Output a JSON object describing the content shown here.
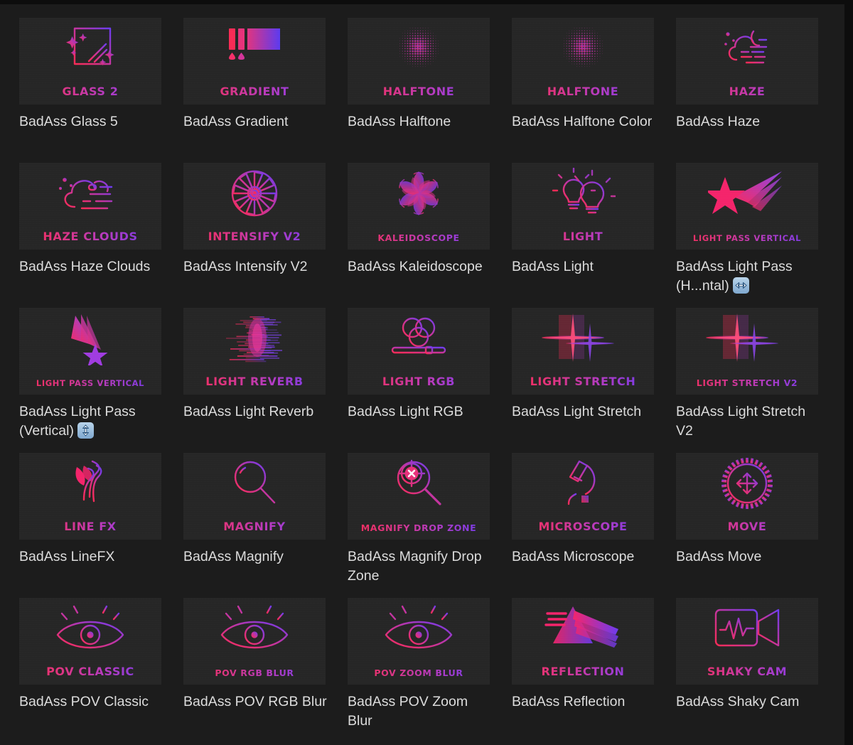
{
  "theme": {
    "page_bg": "#1c1c1c",
    "edge_bg": "#0d0d0d",
    "thumb_bg": "#262626",
    "label_color": "#dcdcdc",
    "gradient_start": "#fa2b55",
    "gradient_mid": "#b43bc4",
    "gradient_end": "#6c3bf0",
    "badge_bg": "#9dc0dd"
  },
  "grid": {
    "columns": 5,
    "rows": 5,
    "total_items": 25
  },
  "items": [
    {
      "label": "BadAss Glass 5",
      "wordmark": "GLASS 2",
      "icon": "glass-icon",
      "wm_size": "md",
      "badge": null
    },
    {
      "label": "BadAss Gradient",
      "wordmark": "GRADIENT",
      "icon": "gradient-icon",
      "wm_size": "md",
      "badge": null
    },
    {
      "label": "BadAss Halftone",
      "wordmark": "HALFTONE",
      "icon": "halftone-icon",
      "wm_size": "md",
      "badge": null
    },
    {
      "label": "BadAss Halftone Color",
      "wordmark": "HALFTONE",
      "icon": "halftone-color-icon",
      "wm_size": "md",
      "badge": null
    },
    {
      "label": "BadAss Haze",
      "wordmark": "HAZE",
      "icon": "haze-icon",
      "wm_size": "md",
      "badge": null
    },
    {
      "label": "BadAss Haze Clouds",
      "wordmark": "HAZE CLOUDS",
      "icon": "haze-clouds-icon",
      "wm_size": "md",
      "badge": null
    },
    {
      "label": "BadAss Intensify V2",
      "wordmark": "INTENSIFY V2",
      "icon": "intensify-icon",
      "wm_size": "md",
      "badge": null
    },
    {
      "label": "BadAss Kaleidoscope",
      "wordmark": "KALEIDOSCOPE",
      "icon": "kaleidoscope-icon",
      "wm_size": "sm",
      "badge": null
    },
    {
      "label": "BadAss Light",
      "wordmark": "LIGHT",
      "icon": "light-bulb-icon",
      "wm_size": "md",
      "badge": null
    },
    {
      "label": "BadAss Light Pass (H...ntal)",
      "wordmark": "LIGHT PASS VERTICAL",
      "icon": "light-pass-horizontal-icon",
      "wm_size": "xs",
      "badge": "arrow-left-right-badge"
    },
    {
      "label": "BadAss Light Pass (Vertical)",
      "wordmark": "LIGHT PASS VERTICAL",
      "icon": "light-pass-vertical-icon",
      "wm_size": "xs",
      "badge": "arrow-up-down-badge"
    },
    {
      "label": "BadAss Light Reverb",
      "wordmark": "LIGHT REVERB",
      "icon": "light-reverb-icon",
      "wm_size": "md",
      "badge": null
    },
    {
      "label": "BadAss Light RGB",
      "wordmark": "LIGHT RGB",
      "icon": "light-rgb-icon",
      "wm_size": "md",
      "badge": null
    },
    {
      "label": "BadAss Light Stretch",
      "wordmark": "LIGHT STRETCH",
      "icon": "light-stretch-icon",
      "wm_size": "md",
      "badge": null
    },
    {
      "label": "BadAss Light Stretch V2",
      "wordmark": "LIGHT STRETCH V2",
      "icon": "light-stretch-v2-icon",
      "wm_size": "sm",
      "badge": null
    },
    {
      "label": "BadAss LineFX",
      "wordmark": "LINE FX",
      "icon": "line-fx-icon",
      "wm_size": "md",
      "badge": null
    },
    {
      "label": "BadAss Magnify",
      "wordmark": "MAGNIFY",
      "icon": "magnify-icon",
      "wm_size": "md",
      "badge": null
    },
    {
      "label": "BadAss Magnify Drop Zone",
      "wordmark": "MAGNIFY DROP ZONE",
      "icon": "magnify-drop-zone-icon",
      "wm_size": "sm",
      "badge": null
    },
    {
      "label": "BadAss Microscope",
      "wordmark": "MICROSCOPE",
      "icon": "microscope-icon",
      "wm_size": "md",
      "badge": null
    },
    {
      "label": "BadAss Move",
      "wordmark": "MOVE",
      "icon": "move-icon",
      "wm_size": "md",
      "badge": null
    },
    {
      "label": "BadAss POV Classic",
      "wordmark": "POV CLASSIC",
      "icon": "pov-classic-eye-icon",
      "wm_size": "md",
      "badge": null
    },
    {
      "label": "BadAss POV RGB Blur",
      "wordmark": "POV RGB BLUR",
      "icon": "pov-rgb-blur-eye-icon",
      "wm_size": "sm",
      "badge": null
    },
    {
      "label": "BadAss POV Zoom Blur",
      "wordmark": "POV ZOOM BLUR",
      "icon": "pov-zoom-blur-eye-icon",
      "wm_size": "sm",
      "badge": null
    },
    {
      "label": "BadAss Reflection",
      "wordmark": "REFLECTION",
      "icon": "reflection-prism-icon",
      "wm_size": "md",
      "badge": null
    },
    {
      "label": "BadAss Shaky Cam",
      "wordmark": "SHAKY CAM",
      "icon": "shaky-cam-icon",
      "wm_size": "md",
      "badge": null
    }
  ]
}
